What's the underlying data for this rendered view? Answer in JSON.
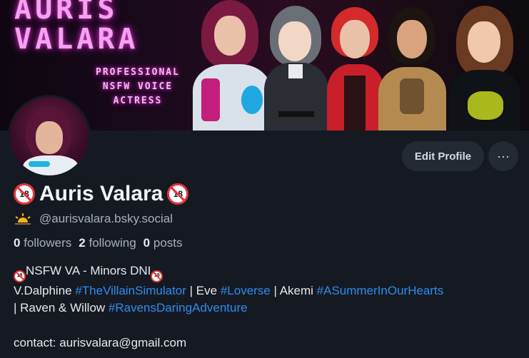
{
  "banner": {
    "title_line1": "AURIS",
    "title_line2": "VALARA",
    "subtitle_line1": "PROFESSIONAL",
    "subtitle_line2": "NSFW VOICE",
    "subtitle_line3": "ACTRESS"
  },
  "profile": {
    "display_name": "Auris Valara",
    "handle": "@aurisvalara.bsky.social",
    "badge_text": "18"
  },
  "actions": {
    "edit_label": "Edit Profile",
    "more_label": "···"
  },
  "stats": {
    "followers_count": "0",
    "followers_label": "followers",
    "following_count": "2",
    "following_label": "following",
    "posts_count": "0",
    "posts_label": "posts"
  },
  "bio": {
    "line1": "NSFW VA - Minors DNI",
    "seg_dalphine": "V.Dalphine ",
    "tag1": "#TheVillainSimulator",
    "seg_eve": " | Eve ",
    "tag2": "#Loverse",
    "seg_akemi": " | Akemi ",
    "tag3": "#ASummerInOurHearts",
    "seg_raven": "| Raven & Willow ",
    "tag4": "#RavensDaringAdventure",
    "contact": "contact: aurisvalara@gmail.com"
  },
  "colors": {
    "background": "#151a22",
    "link": "#2f8cf0",
    "neon_pink": "#f2a3ef",
    "badge_red": "#e2353b"
  },
  "icons": [
    "no-under-18-icon",
    "sunrise-icon",
    "more-dots-icon"
  ]
}
